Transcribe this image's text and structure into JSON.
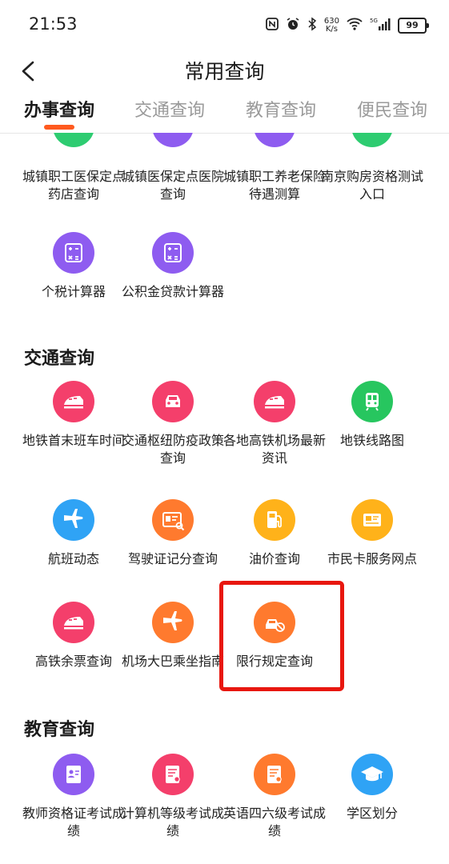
{
  "status_bar": {
    "time": "21:53",
    "net_speed_value": "630",
    "net_speed_unit": "K/s",
    "network": "5G",
    "battery": "99"
  },
  "header": {
    "title": "常用查询"
  },
  "tabs": [
    {
      "label": "办事查询"
    },
    {
      "label": "交通查询"
    },
    {
      "label": "教育查询"
    },
    {
      "label": "便民查询"
    }
  ],
  "sections": {
    "banshi": {
      "items": [
        {
          "label": "城镇职工医保定点药店查询",
          "icon": "partial-icon",
          "color": "#2ecc71"
        },
        {
          "label": "城镇医保定点医院查询",
          "icon": "partial-icon",
          "color": "#8e5cf0"
        },
        {
          "label": "城镇职工养老保险待遇测算",
          "icon": "partial-icon",
          "color": "#8e5cf0"
        },
        {
          "label": "南京购房资格测试入口",
          "icon": "partial-icon",
          "color": "#2ecc71"
        },
        {
          "label": "个税计算器",
          "icon": "calculator-icon",
          "color": "#8e5cf0"
        },
        {
          "label": "公积金贷款计算器",
          "icon": "calculator-icon",
          "color": "#8e5cf0"
        }
      ]
    },
    "jiaotong": {
      "title": "交通查询",
      "items": [
        {
          "label": "地铁首末班车时间",
          "icon": "train-icon",
          "color": "#f43f6b"
        },
        {
          "label": "交通枢纽防疫政策查询",
          "icon": "car-icon",
          "color": "#f43f6b"
        },
        {
          "label": "各地高铁机场最新资讯",
          "icon": "train-icon",
          "color": "#f43f6b"
        },
        {
          "label": "地铁线路图",
          "icon": "metro-icon",
          "color": "#27c65f"
        },
        {
          "label": "航班动态",
          "icon": "airplane-icon",
          "color": "#2fa3f5"
        },
        {
          "label": "驾驶证记分查询",
          "icon": "license-icon",
          "color": "#ff7a2e"
        },
        {
          "label": "油价查询",
          "icon": "fuel-icon",
          "color": "#ffb21a"
        },
        {
          "label": "市民卡服务网点",
          "icon": "card-icon",
          "color": "#ffb21a"
        },
        {
          "label": "高铁余票查询",
          "icon": "train-icon",
          "color": "#f43f6b"
        },
        {
          "label": "机场大巴乘坐指南",
          "icon": "airplane-icon",
          "color": "#ff7a2e"
        },
        {
          "label": "限行规定查询",
          "icon": "restricted-car-icon",
          "color": "#ff7a2e"
        }
      ]
    },
    "jiaoyu": {
      "title": "教育查询",
      "items": [
        {
          "label": "教师资格证考试成绩",
          "icon": "id-card-icon",
          "color": "#8e5cf0"
        },
        {
          "label": "计算机等级考试成绩",
          "icon": "certificate-icon",
          "color": "#f43f6b"
        },
        {
          "label": "英语四六级考试成绩",
          "icon": "certificate-icon",
          "color": "#ff7a2e"
        },
        {
          "label": "学区划分",
          "icon": "graduation-cap-icon",
          "color": "#2fa3f5"
        }
      ]
    }
  }
}
